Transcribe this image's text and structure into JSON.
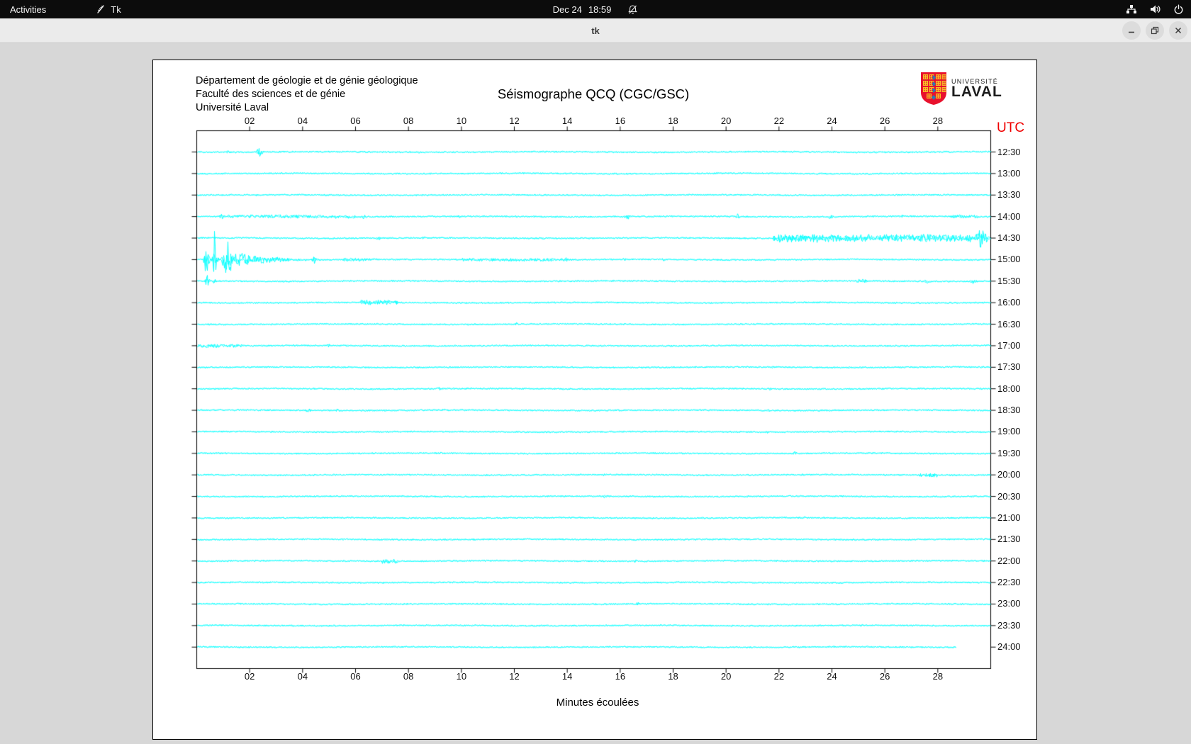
{
  "top_bar": {
    "activities": "Activities",
    "app_name": "Tk",
    "date": "Dec 24",
    "time": "18:59",
    "icons": [
      "tk-feather-icon",
      "bell-muted-icon",
      "network-icon",
      "volume-icon",
      "power-icon"
    ]
  },
  "window": {
    "title": "tk",
    "buttons": [
      "minimize",
      "maximize",
      "close"
    ]
  },
  "header": {
    "line1": "Département de géologie et de génie géologique",
    "line2": "Faculté des sciences et de génie",
    "line3": "Université Laval"
  },
  "logo": {
    "line1": "UNIVERSITÉ",
    "line2": "LAVAL",
    "shield_red": "#e8112d",
    "shield_gold": "#f7c325",
    "shield_blue": "#2a7ab8"
  },
  "chart_data": {
    "type": "line",
    "title": "Séismographe QCQ (CGC/GSC)",
    "xlabel": "Minutes écoulées",
    "right_axis_title": "UTC",
    "x_range_minutes": [
      0,
      30
    ],
    "x_tick_labels": [
      "02",
      "04",
      "06",
      "08",
      "10",
      "12",
      "14",
      "16",
      "18",
      "20",
      "22",
      "24",
      "26",
      "28"
    ],
    "trace_color": "#00ffff",
    "utc_color": "#ef0000",
    "frame_color": "#000000",
    "rows": [
      {
        "utc": "12:30",
        "end_min": 30,
        "events": [
          [
            1.05,
            1.3,
            3,
            "s"
          ],
          [
            2.2,
            2.55,
            7.5,
            "s"
          ],
          [
            8.2,
            8.5,
            2.2,
            "s"
          ],
          [
            13.4,
            13.6,
            2,
            "s"
          ]
        ]
      },
      {
        "utc": "13:00",
        "end_min": 30,
        "events": [
          [
            4.3,
            4.6,
            2,
            "s"
          ],
          [
            19.5,
            19.8,
            2,
            "s"
          ]
        ]
      },
      {
        "utc": "13:30",
        "end_min": 30,
        "events": [
          [
            2.1,
            2.4,
            2,
            "s"
          ],
          [
            26.3,
            26.6,
            2.2,
            "s"
          ]
        ]
      },
      {
        "utc": "14:00",
        "end_min": 30,
        "events": [
          [
            0.75,
            1.15,
            4.5,
            "s"
          ],
          [
            1.2,
            6,
            2.4,
            "f"
          ],
          [
            6.1,
            6.5,
            3.2,
            "s"
          ],
          [
            9.8,
            10.1,
            2.6,
            "s"
          ],
          [
            16.1,
            16.45,
            5,
            "s"
          ],
          [
            20.3,
            20.6,
            4.2,
            "s"
          ],
          [
            23.8,
            24.1,
            3.6,
            "s"
          ],
          [
            26.5,
            26.8,
            2.6,
            "s"
          ],
          [
            28.5,
            29.5,
            2.8,
            "f"
          ]
        ]
      },
      {
        "utc": "14:30",
        "end_min": 30,
        "events": [
          [
            6.7,
            7.05,
            3,
            "s"
          ],
          [
            8.4,
            8.7,
            2.4,
            "s"
          ],
          [
            21.8,
            29.3,
            5.5,
            "f"
          ],
          [
            23.3,
            23.6,
            8,
            "s"
          ],
          [
            29.3,
            29.95,
            16,
            "s"
          ]
        ]
      },
      {
        "utc": "15:00",
        "end_min": 30,
        "events": [
          [
            0.25,
            0.5,
            30,
            "s"
          ],
          [
            0.55,
            0.85,
            18,
            "s"
          ],
          [
            0.62,
            0.72,
            46,
            "s"
          ],
          [
            0.9,
            1.45,
            28,
            "s"
          ],
          [
            1.45,
            5.5,
            11,
            "d"
          ],
          [
            2.0,
            2.3,
            9,
            "s"
          ],
          [
            2.9,
            3.2,
            7,
            "s"
          ],
          [
            4.3,
            4.6,
            6,
            "s"
          ],
          [
            5.5,
            10,
            3.5,
            "d"
          ],
          [
            10,
            14,
            2.2,
            "f"
          ],
          [
            11.2,
            11.5,
            3.4,
            "s"
          ],
          [
            13.8,
            14.1,
            3.2,
            "s"
          ],
          [
            16.0,
            16.3,
            3.0,
            "s"
          ],
          [
            17.5,
            17.8,
            2.6,
            "s"
          ]
        ]
      },
      {
        "utc": "15:30",
        "end_min": 30,
        "events": [
          [
            0.3,
            0.5,
            14,
            "s"
          ],
          [
            0.55,
            0.8,
            4,
            "s"
          ],
          [
            24.9,
            25.3,
            2.4,
            "f"
          ],
          [
            27.4,
            27.75,
            3.2,
            "s"
          ],
          [
            29.1,
            29.6,
            3.6,
            "s"
          ]
        ]
      },
      {
        "utc": "16:00",
        "end_min": 30,
        "events": [
          [
            6.2,
            7.6,
            3.6,
            "f"
          ],
          [
            6.4,
            6.6,
            4.5,
            "s"
          ]
        ]
      },
      {
        "utc": "16:30",
        "end_min": 30,
        "events": [
          [
            0.3,
            0.6,
            2,
            "s"
          ],
          [
            11.9,
            12.25,
            2.6,
            "s"
          ]
        ]
      },
      {
        "utc": "17:00",
        "end_min": 30,
        "events": [
          [
            0,
            1.7,
            2.4,
            "f"
          ],
          [
            4.85,
            5.1,
            2.8,
            "s"
          ],
          [
            23.0,
            23.3,
            2,
            "s"
          ]
        ]
      },
      {
        "utc": "17:30",
        "end_min": 30,
        "events": [
          [
            21.6,
            21.9,
            2.2,
            "s"
          ]
        ]
      },
      {
        "utc": "18:00",
        "end_min": 30,
        "events": [
          [
            9.0,
            9.35,
            2.8,
            "s"
          ],
          [
            21.5,
            21.8,
            2.2,
            "s"
          ]
        ]
      },
      {
        "utc": "18:30",
        "end_min": 30,
        "events": [
          [
            4.0,
            4.45,
            3.4,
            "s"
          ],
          [
            5.15,
            5.5,
            2.8,
            "s"
          ],
          [
            9.2,
            9.5,
            2.2,
            "s"
          ],
          [
            21.5,
            21.8,
            2.4,
            "s"
          ]
        ]
      },
      {
        "utc": "19:00",
        "end_min": 30,
        "events": [
          [
            3.2,
            3.5,
            2,
            "s"
          ],
          [
            21.4,
            21.7,
            2.2,
            "s"
          ]
        ]
      },
      {
        "utc": "19:30",
        "end_min": 30,
        "events": [
          [
            9.1,
            9.4,
            2.2,
            "s"
          ],
          [
            22.4,
            22.8,
            3.4,
            "s"
          ],
          [
            27.5,
            27.85,
            2.4,
            "s"
          ]
        ]
      },
      {
        "utc": "20:00",
        "end_min": 30,
        "events": [
          [
            15.2,
            15.5,
            2.2,
            "s"
          ],
          [
            27.3,
            28.0,
            2.8,
            "f"
          ]
        ]
      },
      {
        "utc": "20:30",
        "end_min": 30,
        "events": [
          [
            15.25,
            15.6,
            2.8,
            "s"
          ]
        ]
      },
      {
        "utc": "21:00",
        "end_min": 30,
        "events": [
          [
            22.8,
            23.1,
            2.2,
            "s"
          ]
        ]
      },
      {
        "utc": "21:30",
        "end_min": 30,
        "events": [
          [
            10.3,
            10.6,
            2,
            "s"
          ],
          [
            23.2,
            23.5,
            2.2,
            "s"
          ]
        ]
      },
      {
        "utc": "22:00",
        "end_min": 30,
        "events": [
          [
            7.0,
            7.6,
            3.4,
            "f"
          ],
          [
            16.4,
            16.75,
            2.8,
            "s"
          ]
        ]
      },
      {
        "utc": "22:30",
        "end_min": 30,
        "events": [
          [
            18.0,
            18.3,
            2.2,
            "s"
          ]
        ]
      },
      {
        "utc": "23:00",
        "end_min": 30,
        "events": [
          [
            16.5,
            16.85,
            3,
            "s"
          ]
        ]
      },
      {
        "utc": "23:30",
        "end_min": 30,
        "events": [
          [
            3.4,
            3.7,
            2.4,
            "s"
          ],
          [
            25.0,
            25.3,
            2.4,
            "s"
          ]
        ]
      },
      {
        "utc": "24:00",
        "end_min": 28.7,
        "events": [
          [
            12.8,
            13.1,
            2.2,
            "s"
          ]
        ]
      }
    ]
  }
}
